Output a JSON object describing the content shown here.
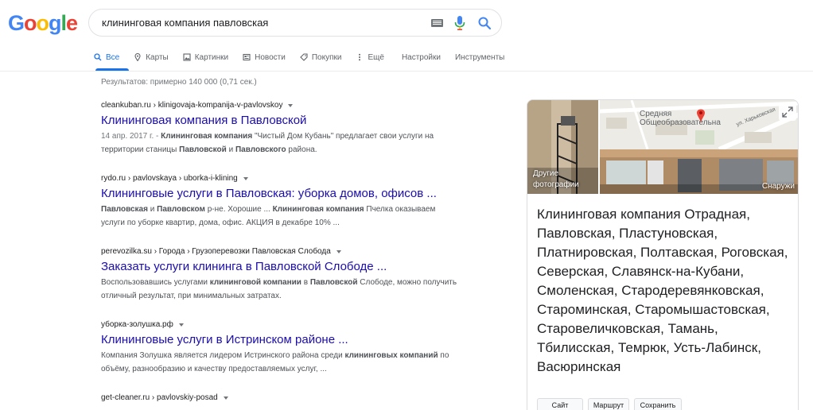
{
  "logo": {
    "letters": [
      "G",
      "o",
      "o",
      "g",
      "l",
      "e"
    ],
    "colors": [
      "#4285F4",
      "#EA4335",
      "#FBBC05",
      "#4285F4",
      "#34A853",
      "#EA4335"
    ]
  },
  "search": {
    "value": "клининговая компания павловская"
  },
  "tabs": [
    {
      "label": "Все",
      "icon": "search-icon",
      "active": true
    },
    {
      "label": "Карты",
      "icon": "map-pin-icon"
    },
    {
      "label": "Картинки",
      "icon": "image-icon"
    },
    {
      "label": "Новости",
      "icon": "news-icon"
    },
    {
      "label": "Покупки",
      "icon": "tag-icon"
    },
    {
      "label": "Ещё",
      "icon": "more-vert-icon"
    },
    {
      "label": "Настройки"
    },
    {
      "label": "Инструменты"
    }
  ],
  "stats": "Результатов: примерно 140 000 (0,71 сек.)",
  "results": [
    {
      "cite": "cleankuban.ru › klinigovaja-kompanija-v-pavlovskoy",
      "title": "Клининговая компания в Павловской",
      "snippet_html": "<span class=\"date\">14 апр. 2017 г. - </span><b>Клининговая компания</b> \"Чистый Дом Кубань\" предлагает свои услуги на территории станицы <b>Павловской</b> и <b>Павловского</b> района."
    },
    {
      "cite": "rydo.ru › pavlovskaya › uborka-i-klining",
      "title": "Клининговые услуги в Павловская: уборка домов, офисов ...",
      "snippet_html": "<b>Павловская</b> и <b>Павловском</b> р-не. Хорошие ... <b>Клининговая компания</b> Пчелка оказываем услуги по уборке квартир, дома, офис. АКЦИЯ в декабре 10% ..."
    },
    {
      "cite": "perevozilka.su › Города › Грузоперевозки Павловская Слобода",
      "title": "Заказать услуги клининга в Павловской Слободе ...",
      "snippet_html": "Воспользовавшись услугами <b>клининговой компании</b> в <b>Павловской</b> Слободе, можно получить отличный результат, при минимальных затратах."
    },
    {
      "cite": "уборка-золушка.рф",
      "title": "Клининговые услуги в Истринском районе ...",
      "snippet_html": "Компания Золушка является лидером Истринского района среди <b>клининговых компаний</b> по объёму, разнообразию и качеству предоставляемых услуг, ..."
    },
    {
      "cite": "get-cleaner.ru › pavlovskiy-posad",
      "title": "",
      "snippet_html": ""
    }
  ],
  "knowledge_panel": {
    "photo_label_left": "Другие фотографии",
    "photo_label_right": "Снаружи",
    "map_labels": [
      "Средняя",
      "Общеобразовательна",
      "ул. Харьковская"
    ],
    "description": "Клининговая компания Отрадная, Павловская, Пластуновская, Платнировская, Полтавская, Роговская, Северская, Славянск-на-Кубани, Смоленская, Стародеревянковская, Староминская, Старомышастовская, Старовеличковская, Тамань, Тбилисская, Темрюк, Усть-Лабинск, Васюринская",
    "actions": [
      "Сайт",
      "Маршрут",
      "Сохранить"
    ]
  },
  "colors": {
    "link": "#1a0dab",
    "accent": "#1a73e8",
    "pin": "#EA4335"
  }
}
